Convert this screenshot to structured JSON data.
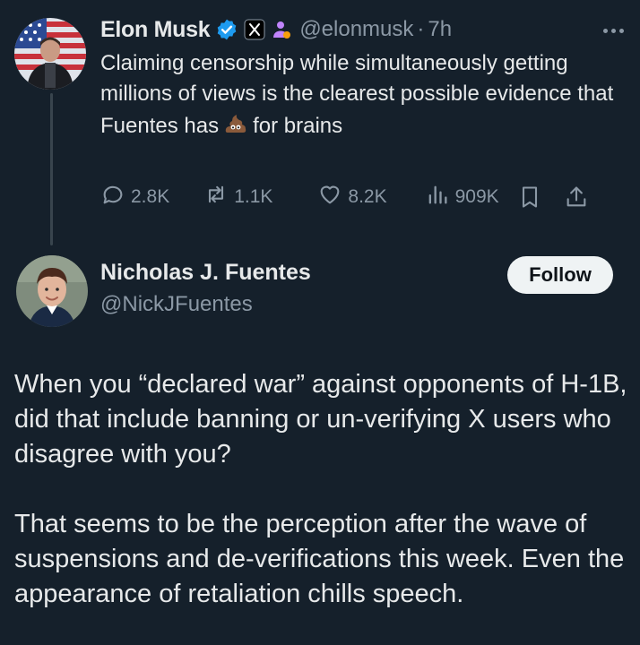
{
  "reply": {
    "author_name": "Elon Musk",
    "handle": "@elonmusk",
    "separator": "·",
    "time": "7h",
    "text_before_emoji": "Claiming censorship while simultaneously getting millions of views is the clearest possible evidence that Fuentes has",
    "emoji": "poop-emoji",
    "text_after_emoji": "for brains",
    "stats": {
      "replies": "2.8K",
      "reposts": "1.1K",
      "likes": "8.2K",
      "views": "909K"
    }
  },
  "quoted_account": {
    "name": "Nicholas J. Fuentes",
    "handle": "@NickJFuentes",
    "follow_label": "Follow"
  },
  "post": {
    "paragraphs": [
      "When you “declared war” against opponents of H-1B, did that include banning or un-verifying X users who disagree with you?",
      "That seems to be the perception after the wave of suspensions and de-verifications this week. Even the appearance of retaliation chills speech."
    ]
  },
  "colors": {
    "background": "#15202b",
    "text": "#e7e9ea",
    "secondary_text": "#8b98a5",
    "verified_badge": "#1d9bf0",
    "follow_button_bg": "#eff3f4"
  },
  "icons": [
    "verified-badge-icon",
    "x-logo-icon",
    "affiliate-person-icon",
    "more-icon",
    "reply-icon",
    "repost-icon",
    "like-icon",
    "views-icon",
    "bookmark-icon",
    "share-icon"
  ]
}
